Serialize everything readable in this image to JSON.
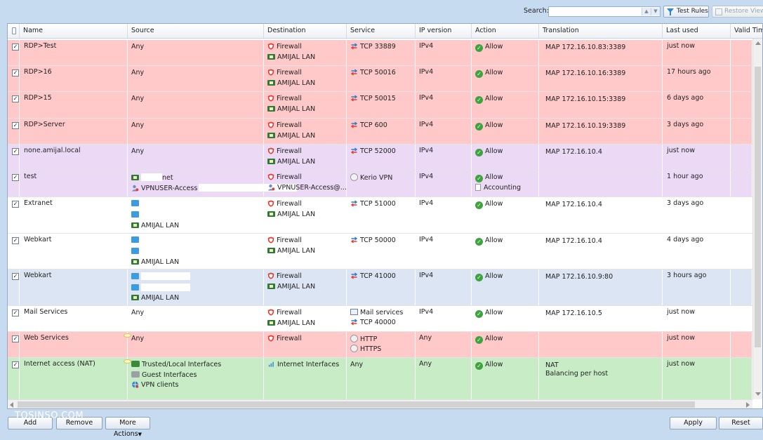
{
  "toolbar": {
    "search_label": "Search:",
    "search_value": "",
    "test_rules_label": "Test Rules",
    "restore_view_label": "Restore View"
  },
  "columns": {
    "name": "Name",
    "source": "Source",
    "destination": "Destination",
    "service": "Service",
    "ip_version": "IP version",
    "action": "Action",
    "translation": "Translation",
    "last_used": "Last used",
    "valid_time": "Valid Time"
  },
  "row_colors": {
    "red": "#ffc9c9",
    "purple": "#ecd9f5",
    "white": "#ffffff",
    "blue": "#dbe5f3",
    "green": "#c8ecc6"
  },
  "rules": [
    {
      "name": "RDP>Test",
      "color": "red",
      "source": [
        {
          "icon": "none",
          "text": "Any"
        }
      ],
      "destination": [
        {
          "icon": "firewall-icon",
          "text": "Firewall"
        },
        {
          "icon": "lan-icon",
          "text": "AMIJAL LAN"
        }
      ],
      "service": [
        {
          "icon": "service-icon",
          "text": "TCP 33889"
        }
      ],
      "ip_version": "IPv4",
      "action": [
        {
          "icon": "allow-icon",
          "text": "Allow"
        }
      ],
      "translation": [
        "MAP 172.16.10.83:3389"
      ],
      "last_used": "just now"
    },
    {
      "name": "RDP>16",
      "color": "red",
      "source": [
        {
          "icon": "none",
          "text": "Any"
        }
      ],
      "destination": [
        {
          "icon": "firewall-icon",
          "text": "Firewall"
        },
        {
          "icon": "lan-icon",
          "text": "AMIJAL LAN"
        }
      ],
      "service": [
        {
          "icon": "service-icon",
          "text": "TCP 50016"
        }
      ],
      "ip_version": "IPv4",
      "action": [
        {
          "icon": "allow-icon",
          "text": "Allow"
        }
      ],
      "translation": [
        "MAP 172.16.10.16:3389"
      ],
      "last_used": "17 hours ago"
    },
    {
      "name": "RDP>15",
      "color": "red",
      "source": [
        {
          "icon": "none",
          "text": "Any"
        }
      ],
      "destination": [
        {
          "icon": "firewall-icon",
          "text": "Firewall"
        },
        {
          "icon": "lan-icon",
          "text": "AMIJAL LAN"
        }
      ],
      "service": [
        {
          "icon": "service-icon",
          "text": "TCP 50015"
        }
      ],
      "ip_version": "IPv4",
      "action": [
        {
          "icon": "allow-icon",
          "text": "Allow"
        }
      ],
      "translation": [
        "MAP 172.16.10.15:3389"
      ],
      "last_used": "6 days ago"
    },
    {
      "name": "RDP>Server",
      "color": "red",
      "source": [
        {
          "icon": "none",
          "text": "Any"
        }
      ],
      "destination": [
        {
          "icon": "firewall-icon",
          "text": "Firewall"
        },
        {
          "icon": "lan-icon",
          "text": "AMIJAL LAN"
        }
      ],
      "service": [
        {
          "icon": "service-icon",
          "text": "TCP 600"
        }
      ],
      "ip_version": "IPv4",
      "action": [
        {
          "icon": "allow-icon",
          "text": "Allow"
        }
      ],
      "translation": [
        "MAP 172.16.10.19:3389"
      ],
      "last_used": "3 days ago"
    },
    {
      "name": "none.amijal.local",
      "color": "purple",
      "source": [
        {
          "icon": "none",
          "text": "Any"
        }
      ],
      "destination": [
        {
          "icon": "firewall-icon",
          "text": "Firewall"
        },
        {
          "icon": "lan-icon",
          "text": "AMIJAL LAN"
        }
      ],
      "service": [
        {
          "icon": "service-icon",
          "text": "TCP 52000"
        }
      ],
      "ip_version": "IPv4",
      "action": [
        {
          "icon": "allow-icon",
          "text": "Allow"
        }
      ],
      "translation": [
        "MAP 172.16.10.4"
      ],
      "last_used": "just now"
    },
    {
      "name": "test",
      "color": "purple",
      "source": [
        {
          "icon": "lan-icon",
          "text": "net",
          "redact": 1
        },
        {
          "icon": "user-icon",
          "text": "VPNUSER-Access",
          "redact": 2
        }
      ],
      "destination": [
        {
          "icon": "firewall-icon",
          "text": "Firewall"
        },
        {
          "icon": "user-icon",
          "text": "VPNUSER-Access@..."
        }
      ],
      "service": [
        {
          "icon": "kerio-vpn-icon",
          "text": "Kerio VPN"
        }
      ],
      "ip_version": "IPv4",
      "action": [
        {
          "icon": "allow-icon",
          "text": "Allow"
        },
        {
          "icon": "accounting-icon",
          "text": "Accounting"
        }
      ],
      "translation": [],
      "last_used": "1 hour ago"
    },
    {
      "name": "Extranet",
      "color": "white",
      "source": [
        {
          "icon": "host-icon",
          "text": ""
        },
        {
          "icon": "host-icon",
          "text": ""
        },
        {
          "icon": "lan-icon",
          "text": "AMIJAL LAN"
        }
      ],
      "destination": [
        {
          "icon": "firewall-icon",
          "text": "Firewall"
        },
        {
          "icon": "lan-icon",
          "text": "AMIJAL LAN"
        }
      ],
      "service": [
        {
          "icon": "service-icon",
          "text": "TCP 51000"
        }
      ],
      "ip_version": "IPv4",
      "action": [
        {
          "icon": "allow-icon",
          "text": "Allow"
        }
      ],
      "translation": [
        "MAP 172.16.10.4"
      ],
      "last_used": "3 days ago"
    },
    {
      "name": "Webkart",
      "color": "white",
      "source": [
        {
          "icon": "host-icon",
          "text": ""
        },
        {
          "icon": "host-icon",
          "text": ""
        },
        {
          "icon": "lan-icon",
          "text": "AMIJAL LAN"
        }
      ],
      "destination": [
        {
          "icon": "firewall-icon",
          "text": "Firewall"
        },
        {
          "icon": "lan-icon",
          "text": "AMIJAL LAN"
        }
      ],
      "service": [
        {
          "icon": "service-icon",
          "text": "TCP 50000"
        }
      ],
      "ip_version": "IPv4",
      "action": [
        {
          "icon": "allow-icon",
          "text": "Allow"
        }
      ],
      "translation": [
        "MAP 172.16.10.4"
      ],
      "last_used": "4 days ago"
    },
    {
      "name": "Webkart",
      "color": "blue",
      "source": [
        {
          "icon": "host-icon",
          "text": "",
          "redact": 3
        },
        {
          "icon": "host-icon",
          "text": "",
          "redact": 3
        },
        {
          "icon": "lan-icon",
          "text": "AMIJAL LAN"
        }
      ],
      "destination": [
        {
          "icon": "firewall-icon",
          "text": "Firewall"
        },
        {
          "icon": "lan-icon",
          "text": "AMIJAL LAN"
        }
      ],
      "service": [
        {
          "icon": "service-icon",
          "text": "TCP 41000"
        }
      ],
      "ip_version": "IPv4",
      "action": [
        {
          "icon": "allow-icon",
          "text": "Allow"
        }
      ],
      "translation": [
        "MAP 172.16.10.9:80"
      ],
      "last_used": "3 hours ago"
    },
    {
      "name": "Mail Services",
      "color": "white",
      "source": [
        {
          "icon": "none",
          "text": "Any"
        }
      ],
      "destination": [
        {
          "icon": "firewall-icon",
          "text": "Firewall"
        },
        {
          "icon": "lan-icon",
          "text": "AMIJAL LAN"
        }
      ],
      "service": [
        {
          "icon": "mail-icon",
          "text": "Mail services"
        },
        {
          "icon": "service-icon",
          "text": "TCP 40000"
        }
      ],
      "ip_version": "IPv4",
      "action": [
        {
          "icon": "allow-icon",
          "text": "Allow"
        }
      ],
      "translation": [
        "MAP 172.16.10.5"
      ],
      "last_used": "just now"
    },
    {
      "name": "Web Services",
      "color": "red",
      "comment": true,
      "source": [
        {
          "icon": "none",
          "text": "Any"
        }
      ],
      "destination": [
        {
          "icon": "firewall-icon",
          "text": "Firewall"
        }
      ],
      "service": [
        {
          "icon": "web-icon",
          "text": "HTTP"
        },
        {
          "icon": "web-icon",
          "text": "HTTPS"
        }
      ],
      "ip_version": "Any",
      "action": [
        {
          "icon": "allow-icon",
          "text": "Allow"
        }
      ],
      "translation": [],
      "last_used": "just now"
    },
    {
      "name": "Internet access (NAT)",
      "color": "green",
      "comment": true,
      "source": [
        {
          "icon": "trusted-interfaces-icon",
          "text": "Trusted/Local Interfaces"
        },
        {
          "icon": "guest-interfaces-icon",
          "text": "Guest Interfaces"
        },
        {
          "icon": "vpn-clients-icon",
          "text": "VPN clients"
        }
      ],
      "destination": [
        {
          "icon": "internet-interfaces-icon",
          "text": "Internet Interfaces"
        }
      ],
      "service": [
        {
          "icon": "none",
          "text": "Any"
        }
      ],
      "ip_version": "Any",
      "action": [
        {
          "icon": "allow-icon",
          "text": "Allow"
        }
      ],
      "translation": [
        "NAT",
        "Balancing per host"
      ],
      "last_used": "just now"
    }
  ],
  "bottom": {
    "add_label": "Add",
    "remove_label": "Remove",
    "more_actions_label": "More Actions",
    "apply_label": "Apply",
    "reset_label": "Reset",
    "watermark": "TOSINSO.COM"
  }
}
